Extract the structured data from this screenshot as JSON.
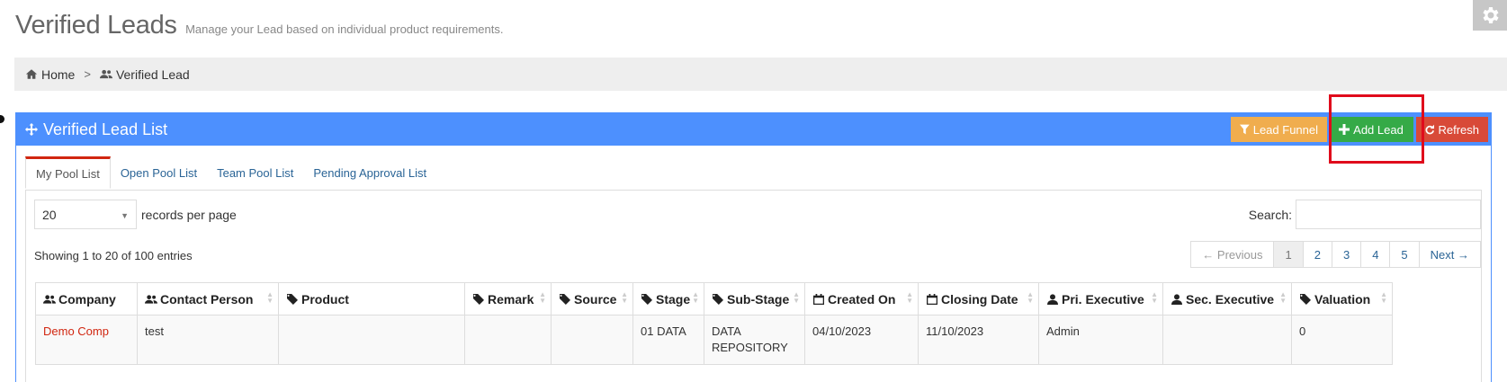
{
  "page": {
    "title": "Verified Leads",
    "subtitle": "Manage your Lead based on individual product requirements."
  },
  "breadcrumb": {
    "home": "Home",
    "current": "Verified Lead"
  },
  "portlet": {
    "title": "Verified Lead List",
    "actions": {
      "funnel": "Lead Funnel",
      "add": "Add Lead",
      "refresh": "Refresh"
    }
  },
  "tabs": [
    "My Pool List",
    "Open Pool List",
    "Team Pool List",
    "Pending Approval List"
  ],
  "length": {
    "value": "20",
    "label": "records per page"
  },
  "search": {
    "label": "Search:",
    "value": ""
  },
  "info": "Showing 1 to 20 of 100 entries",
  "pagination": {
    "prev": "← Previous",
    "pages": [
      "1",
      "2",
      "3",
      "4",
      "5"
    ],
    "next": "Next →"
  },
  "table": {
    "columns": [
      "Company",
      "Contact Person",
      "Product",
      "Remark",
      "Source",
      "Stage",
      "Sub-Stage",
      "Created On",
      "Closing Date",
      "Pri. Executive",
      "Sec. Executive",
      "Valuation"
    ],
    "rows": [
      {
        "company": "Demo Comp",
        "contact": "test",
        "product": "",
        "remark": "",
        "source": "",
        "stage": "01 DATA",
        "sub_stage": "DATA REPOSITORY",
        "created_on": "04/10/2023",
        "closing_date": "11/10/2023",
        "pri_exec": "Admin",
        "sec_exec": "",
        "valuation": "0"
      }
    ]
  },
  "colors": {
    "primary": "#4d90fe",
    "funnel": "#f0ad4e",
    "add": "#35aa47",
    "refresh": "#d84a38",
    "active_tab": "#d12610",
    "highlight": "#e00b1c"
  }
}
